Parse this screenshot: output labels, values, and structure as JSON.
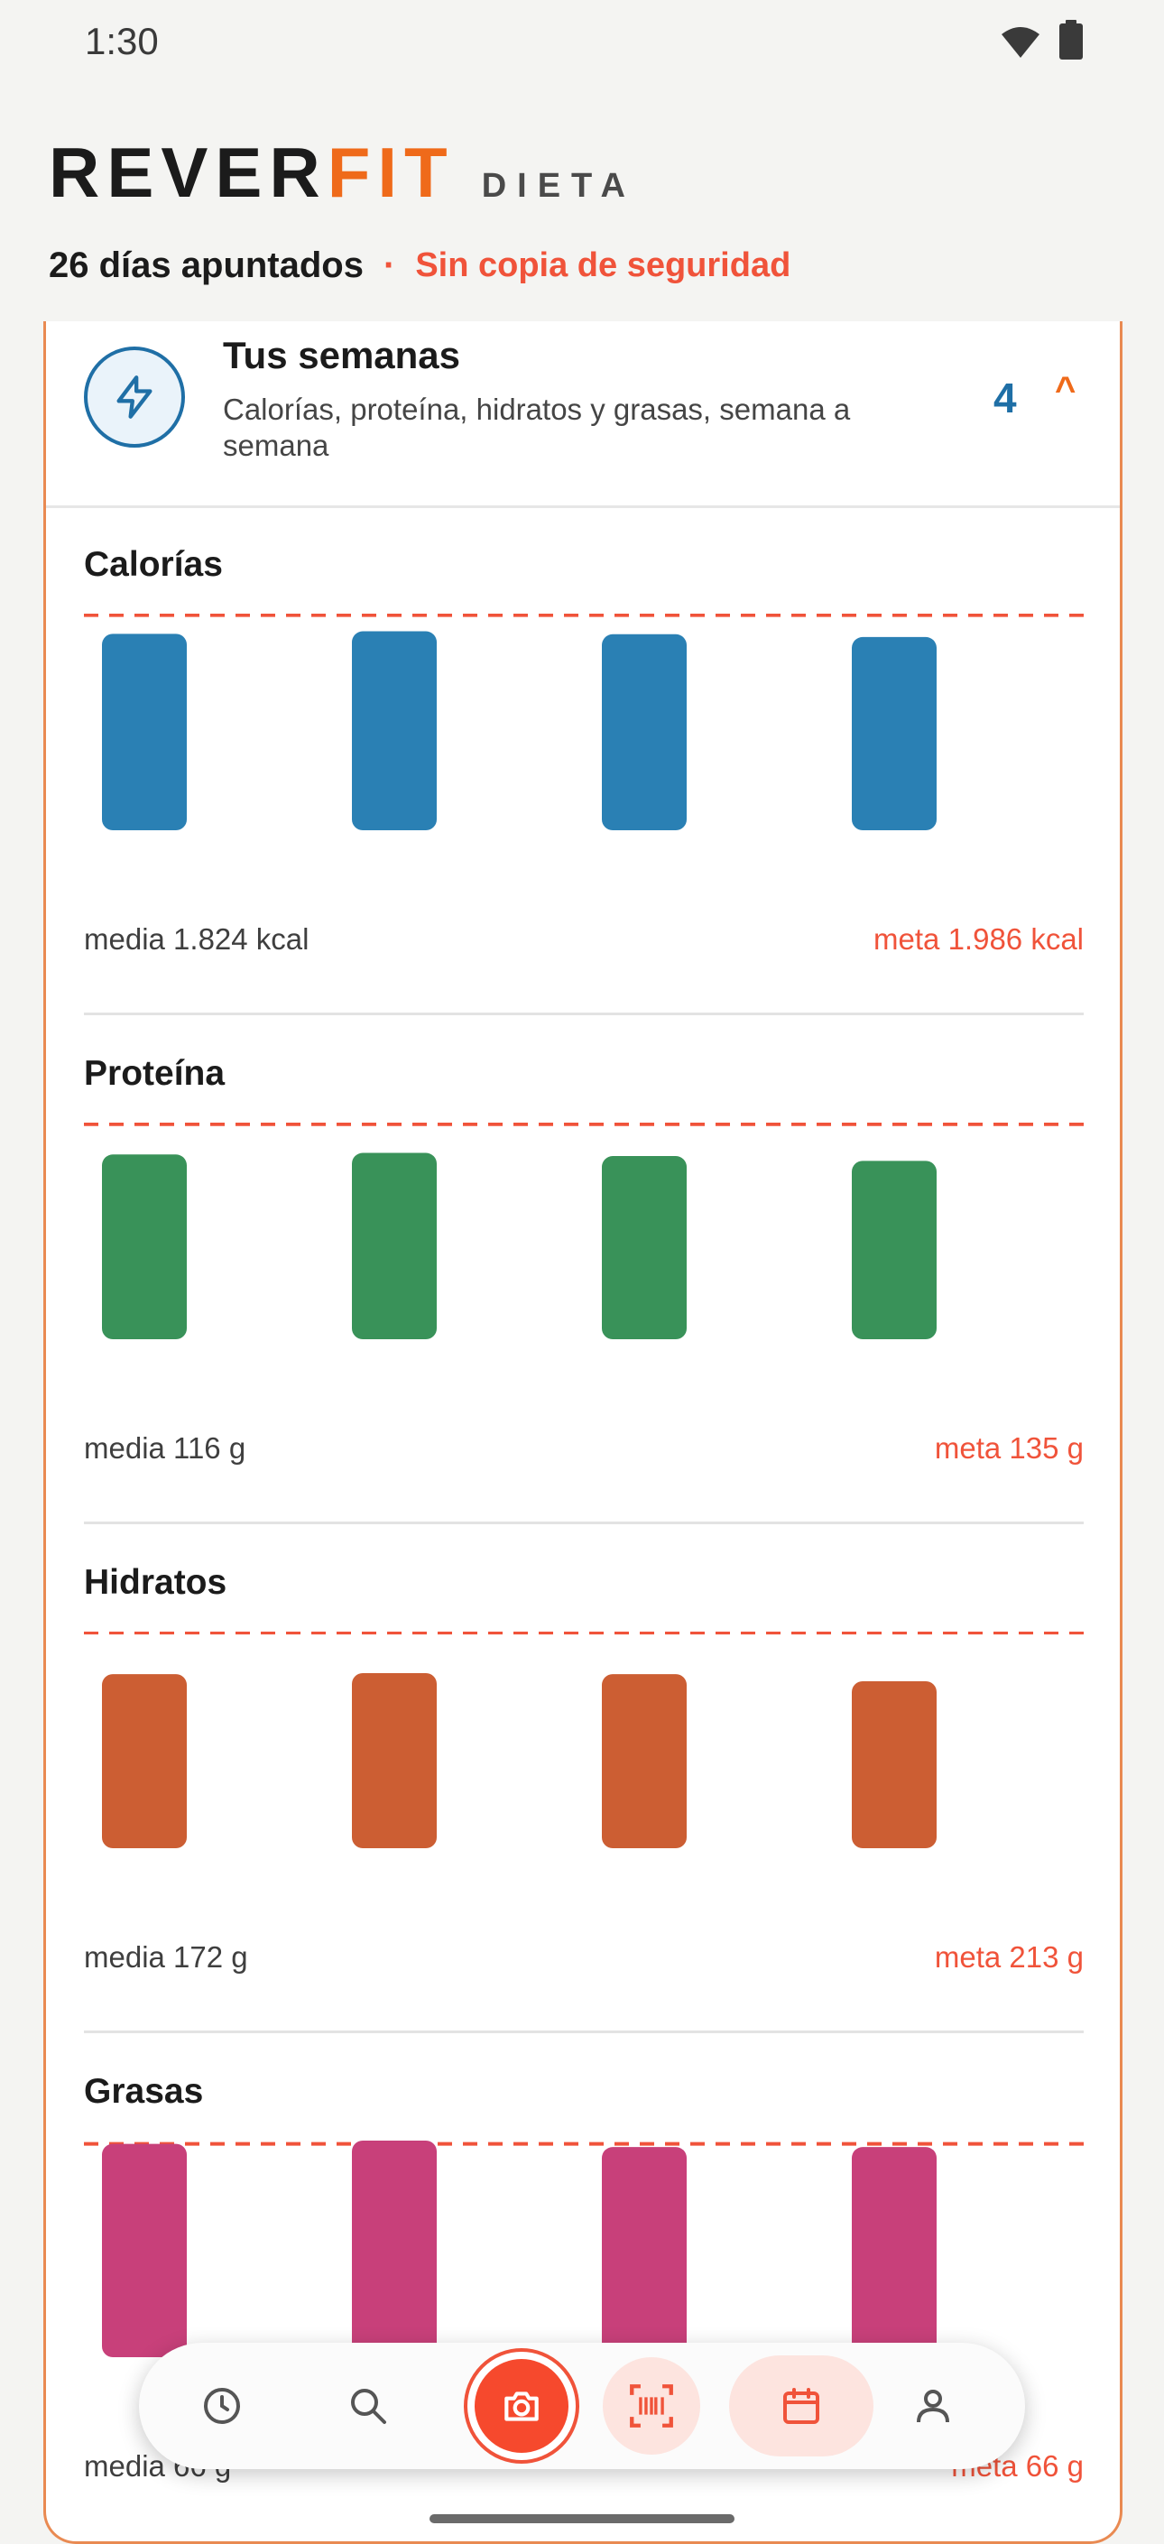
{
  "status_bar": {
    "time": "1:30",
    "icons": [
      "wifi-icon",
      "battery-icon"
    ]
  },
  "brand": {
    "rever": "REVER",
    "fit": "FIT",
    "section": "DIETA"
  },
  "summary": {
    "days_logged": "26 días apuntados",
    "separator": "·",
    "backup_status": "Sin copia de seguridad"
  },
  "weeks": {
    "title": "Tus semanas",
    "description": "Calorías, proteína, hidratos y grasas, semana a semana",
    "count": "4",
    "collapse_glyph": "^"
  },
  "colors": {
    "accent": "#ef6a1a",
    "warning": "#f0533a",
    "calories": "#2a80b4",
    "protein": "#399259",
    "carbs": "#cc5e33",
    "fat": "#c8407a"
  },
  "sections": [
    {
      "key": "calories",
      "title": "Calorías",
      "average": "media 1.824 kcal",
      "goal": "meta 1.986 kcal"
    },
    {
      "key": "protein",
      "title": "Proteína",
      "average": "media 116 g",
      "goal": "meta 135 g"
    },
    {
      "key": "carbs",
      "title": "Hidratos",
      "average": "media 172 g",
      "goal": "meta 213 g"
    },
    {
      "key": "fat",
      "title": "Grasas",
      "average": "media 66 g",
      "goal": "meta 66 g"
    }
  ],
  "chart_data": [
    {
      "type": "bar",
      "title": "Calorías",
      "categories": [
        "",
        "",
        "",
        ""
      ],
      "values": [
        1814,
        1837,
        1810,
        1784
      ],
      "goal": 1986,
      "ylim": [
        0,
        2000
      ],
      "color": "#2a80b4"
    },
    {
      "type": "bar",
      "title": "Proteína",
      "categories": [
        "",
        "",
        "",
        ""
      ],
      "values": [
        116,
        117,
        115,
        112
      ],
      "goal": 135,
      "ylim": [
        0,
        136
      ],
      "color": "#399259"
    },
    {
      "type": "bar",
      "title": "Hidratos",
      "categories": [
        "",
        "",
        "",
        ""
      ],
      "values": [
        172,
        173,
        172,
        165
      ],
      "goal": 213,
      "ylim": [
        0,
        214
      ],
      "color": "#cc5e33"
    },
    {
      "type": "bar",
      "title": "Grasas",
      "categories": [
        "",
        "",
        "",
        ""
      ],
      "values": [
        66,
        67,
        65,
        65
      ],
      "goal": 66,
      "ylim": [
        0,
        67
      ],
      "color": "#c8407a"
    }
  ],
  "bottom_nav": {
    "items": [
      {
        "icon": "history-icon"
      },
      {
        "icon": "search-icon"
      },
      {
        "icon": "camera-icon"
      },
      {
        "icon": "barcode-scan-icon"
      },
      {
        "icon": "calendar-icon"
      },
      {
        "icon": "profile-icon"
      }
    ]
  }
}
